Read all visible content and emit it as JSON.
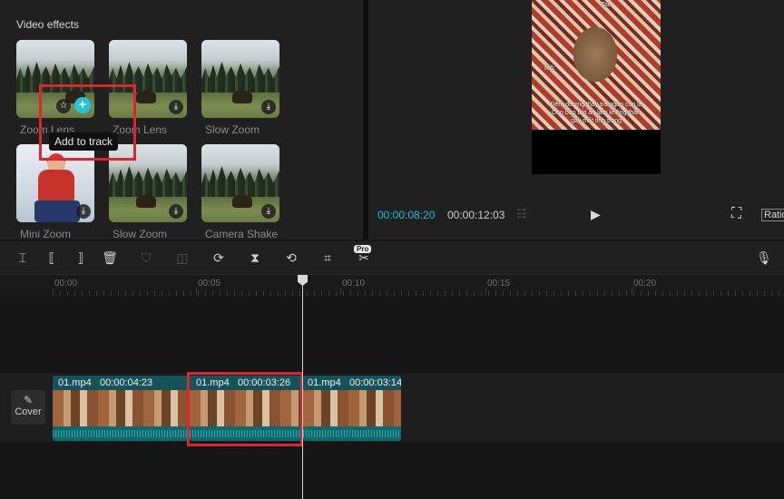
{
  "effects_panel": {
    "title": "Video effects",
    "items": [
      {
        "label": "Zoom Lens"
      },
      {
        "label": "Zoom Lens"
      },
      {
        "label": "Slow Zoom"
      },
      {
        "label": "Mini Zoom"
      },
      {
        "label": "Slow Zoom"
      },
      {
        "label": "Camera Shake"
      }
    ],
    "tooltip": "Add to track",
    "add_symbol": "+",
    "star_symbol": "☆",
    "download_symbol": "⤓"
  },
  "preview": {
    "captions": [
      "Tao:",
      "Mõ:",
      "Đêm dương thay trả ngao còn là",
      "Còn bao bởi ăn làm không thần",
      "gây mất tinh trong"
    ],
    "current_time": "00:00:08:20",
    "total_time": "00:00:12:03",
    "ratio_label": "Ratio"
  },
  "toolbar": {
    "pro_badge": "Pro"
  },
  "ruler": {
    "ticks": [
      "00:00",
      "00:05",
      "00:10",
      "00:15",
      "00:20"
    ]
  },
  "timeline": {
    "cover_label": "Cover",
    "clips": [
      {
        "name": "01.mp4",
        "duration": "00:00:04:23"
      },
      {
        "name": "01.mp4",
        "duration": "00:00:03:26"
      },
      {
        "name": "01.mp4",
        "duration": "00:00:03:14"
      }
    ]
  },
  "colors": {
    "accent": "#1fc7d6",
    "highlight": "#e0242c",
    "clip": "#0f5c5c"
  }
}
